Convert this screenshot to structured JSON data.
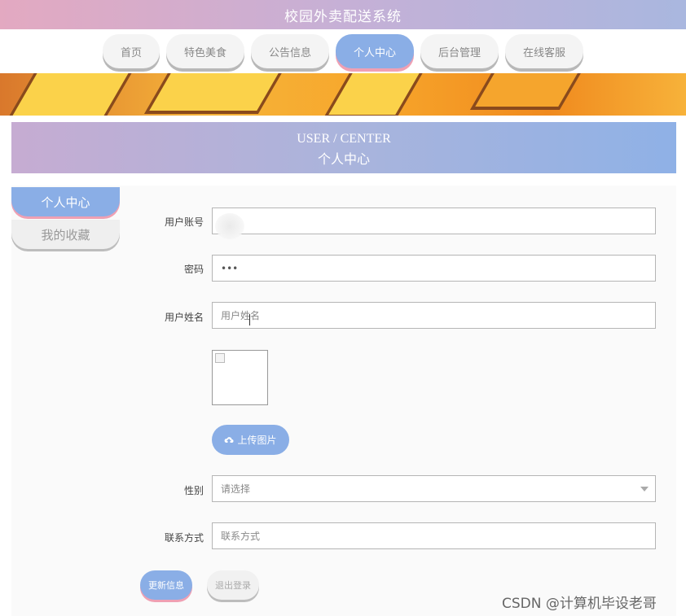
{
  "app": {
    "title": "校园外卖配送系统"
  },
  "nav": {
    "items": [
      {
        "label": "首页",
        "active": false
      },
      {
        "label": "特色美食",
        "active": false
      },
      {
        "label": "公告信息",
        "active": false
      },
      {
        "label": "个人中心",
        "active": true
      },
      {
        "label": "后台管理",
        "active": false
      },
      {
        "label": "在线客服",
        "active": false
      }
    ]
  },
  "section": {
    "title_en": "USER / CENTER",
    "title_cn": "个人中心"
  },
  "sidebar": {
    "items": [
      {
        "label": "个人中心",
        "active": true
      },
      {
        "label": "我的收藏",
        "active": false
      }
    ]
  },
  "form": {
    "account_label": "用户账号",
    "account_value": "",
    "password_label": "密码",
    "password_value": "•••",
    "name_label": "用户姓名",
    "name_placeholder": "用户姓名",
    "upload_label": "上传图片",
    "gender_label": "性别",
    "gender_placeholder": "请选择",
    "contact_label": "联系方式",
    "contact_placeholder": "联系方式"
  },
  "actions": {
    "update_label": "更新信息",
    "logout_label": "退出登录"
  },
  "watermark": "CSDN @计算机毕设老哥",
  "colors": {
    "accent": "#8aaee6",
    "pink": "#efa0b3"
  }
}
